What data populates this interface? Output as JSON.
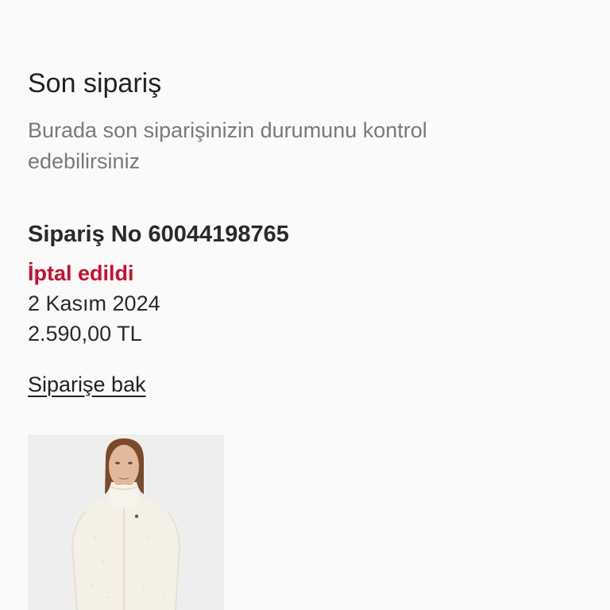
{
  "recent_order": {
    "title": "Son sipariş",
    "subtitle": "Burada son siparişinizin durumunu kontrol edebilirsiniz",
    "order_number": "Sipariş No 60044198765",
    "status": "İptal edildi",
    "date": "2 Kasım 2024",
    "total": "2.590,00 TL",
    "view_link": "Siparişe bak",
    "product_image_icon": "product-photo-white-jacket"
  },
  "colors": {
    "status_cancelled": "#c8102e",
    "text_primary": "#222222",
    "text_secondary": "#7a7a7a",
    "background": "#fafafa",
    "image_background": "#eeeeee"
  }
}
